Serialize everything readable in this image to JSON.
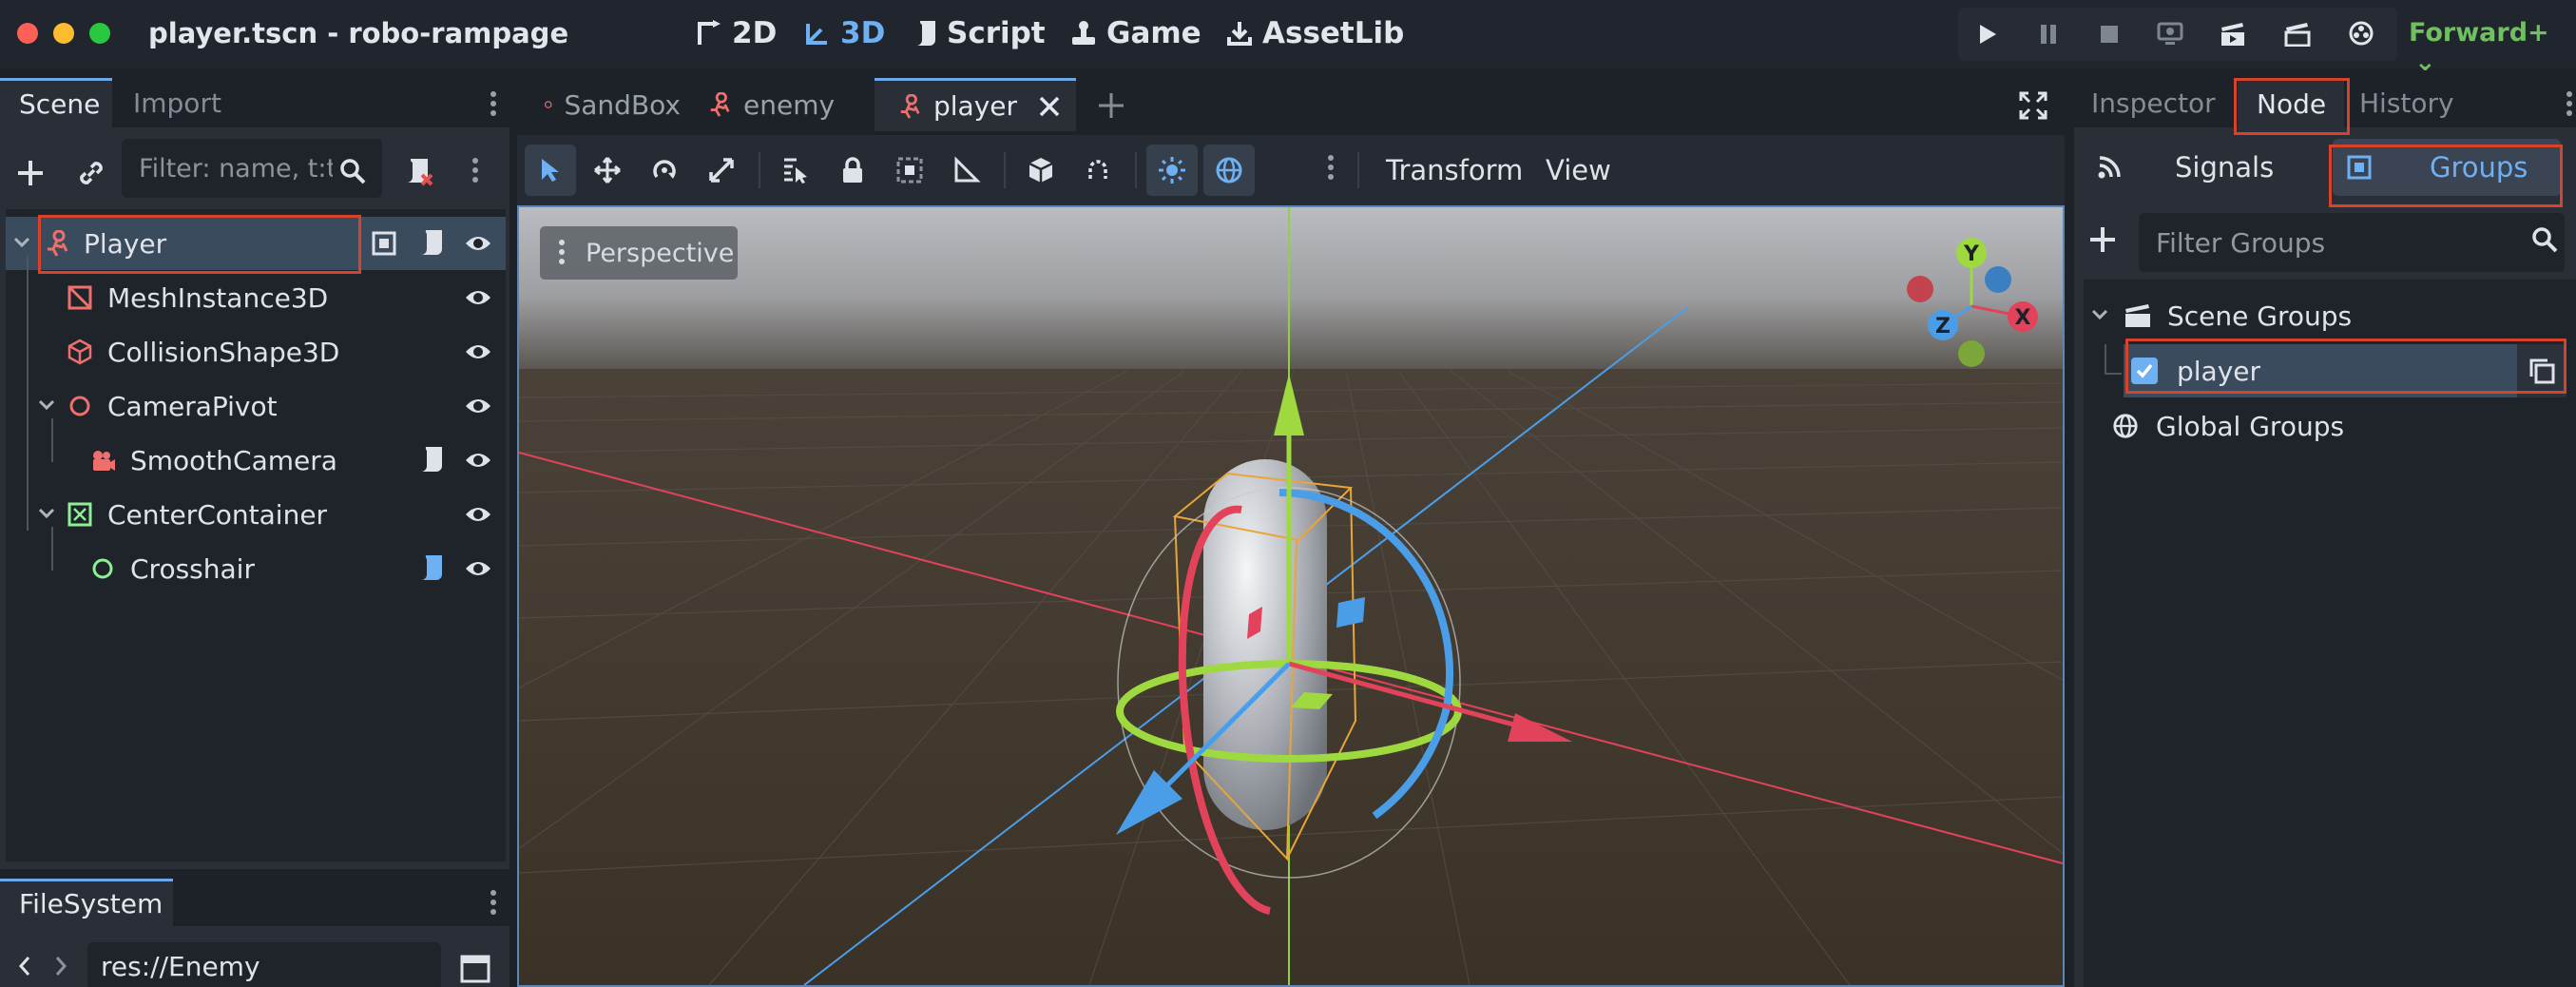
{
  "window": {
    "title": "player.tscn - robo-rampage",
    "traffic_colors": [
      "#fe5f57",
      "#febc2e",
      "#28c840"
    ]
  },
  "main_modes": [
    {
      "label": "2D",
      "icon": "2d-icon",
      "active": false
    },
    {
      "label": "3D",
      "icon": "3d-icon",
      "active": true
    },
    {
      "label": "Script",
      "icon": "script-icon",
      "active": false
    },
    {
      "label": "Game",
      "icon": "game-icon",
      "active": false
    },
    {
      "label": "AssetLib",
      "icon": "assetlib-icon",
      "active": false
    }
  ],
  "run_buttons": [
    "play-icon",
    "pause-icon",
    "stop-icon",
    "remote-debug-icon",
    "play-scene-icon",
    "play-custom-scene-icon",
    "movie-maker-icon"
  ],
  "renderer": "Forward+",
  "left_dock": {
    "tabs": [
      "Scene",
      "Import"
    ],
    "active_tab": "Scene",
    "filter_placeholder": "Filter: name, t:t",
    "tree": [
      {
        "label": "Player",
        "icon": "character-body-icon",
        "selected": true,
        "expanded": true,
        "has_script": true,
        "has_group": true
      },
      {
        "label": "MeshInstance3D",
        "icon": "mesh-instance-icon"
      },
      {
        "label": "CollisionShape3D",
        "icon": "collision-shape-icon"
      },
      {
        "label": "CameraPivot",
        "icon": "node3d-icon",
        "expanded": true
      },
      {
        "label": "SmoothCamera",
        "icon": "camera-icon",
        "has_script": true
      },
      {
        "label": "CenterContainer",
        "icon": "center-container-icon",
        "expanded": true
      },
      {
        "label": "Crosshair",
        "icon": "control-icon",
        "has_script": true
      }
    ]
  },
  "filesystem": {
    "tab": "FileSystem",
    "path": "res://Enemy"
  },
  "editor_tabs": [
    {
      "label": "SandBox",
      "icon": "node3d-icon",
      "active": false
    },
    {
      "label": "enemy",
      "icon": "character-body-icon",
      "active": false
    },
    {
      "label": "player",
      "icon": "character-body-icon",
      "active": true
    }
  ],
  "toolbar": {
    "transform_label": "Transform",
    "view_label": "View"
  },
  "viewport": {
    "perspective_label": "Perspective",
    "gizmo_axes": {
      "x": "X",
      "y": "Y",
      "z": "Z"
    }
  },
  "right_dock": {
    "tabs": [
      "Inspector",
      "Node",
      "History"
    ],
    "active_tab": "Node",
    "subtabs": [
      "Signals",
      "Groups"
    ],
    "active_subtab": "Groups",
    "filter_placeholder": "Filter Groups",
    "scene_groups_label": "Scene Groups",
    "groups": [
      {
        "name": "player",
        "checked": true
      }
    ],
    "global_groups_label": "Global Groups"
  },
  "colors": {
    "accent": "#6fb0f2",
    "highlight": "#d4432a",
    "renderer": "#70bf61",
    "axis_x": "#e3435a",
    "axis_y": "#8ed23f",
    "axis_z": "#4a9ee8"
  }
}
